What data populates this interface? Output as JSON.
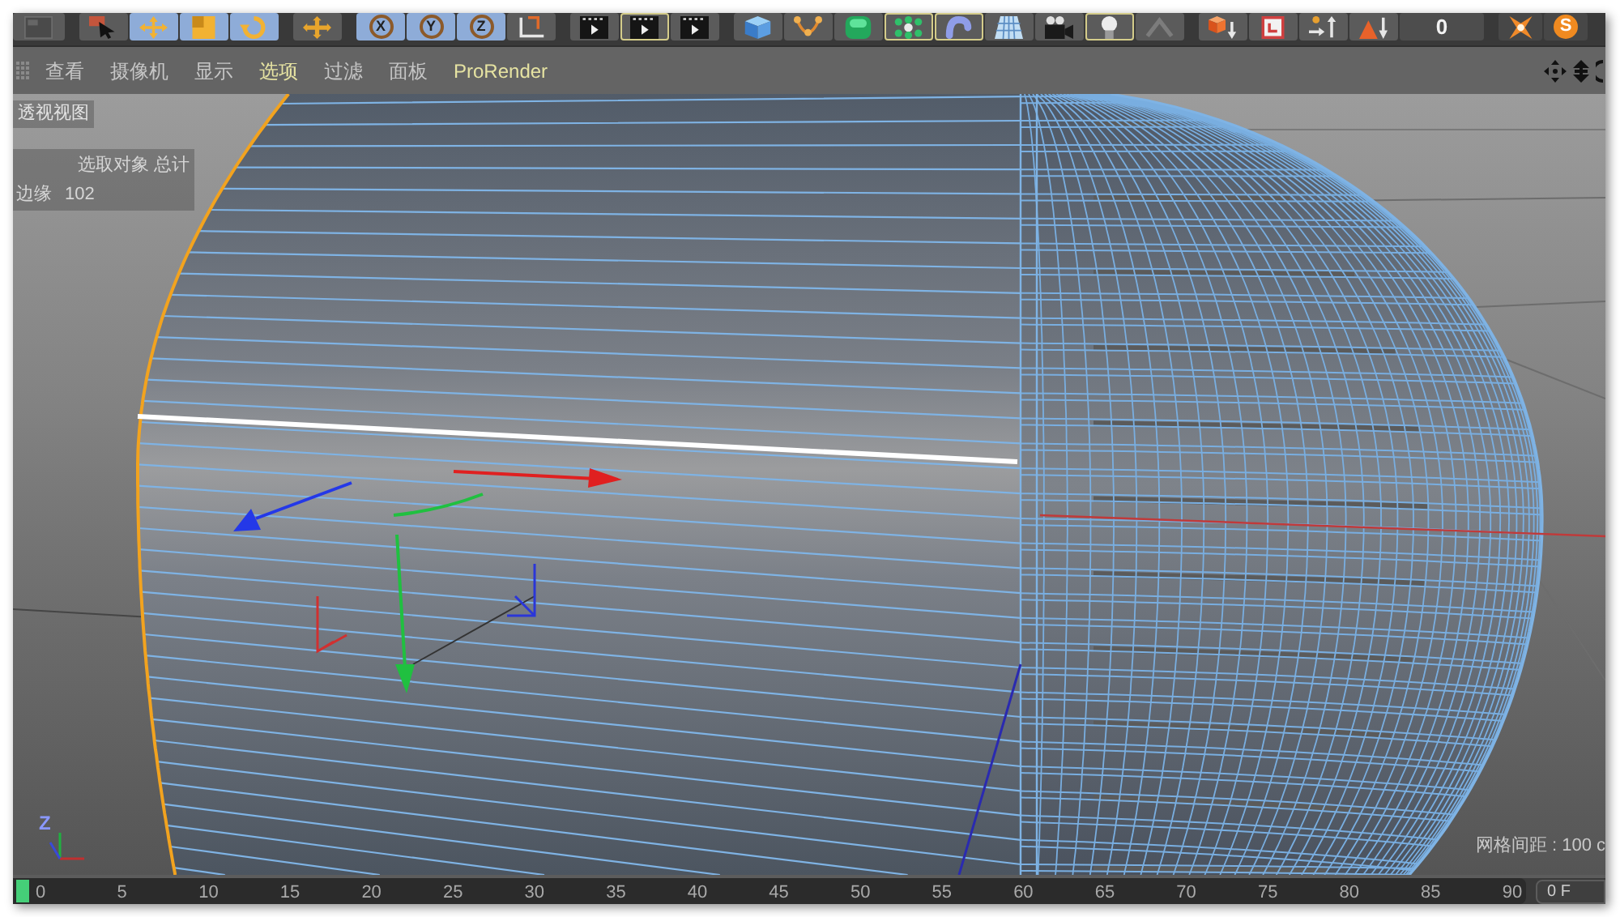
{
  "toolbar": {
    "groups": [
      [
        {
          "kind": "panel",
          "selected": false,
          "framed": false
        }
      ],
      [
        {
          "kind": "cursor",
          "selected": false,
          "framed": false
        },
        {
          "kind": "move",
          "selected": true,
          "framed": false
        },
        {
          "kind": "scale",
          "selected": true,
          "framed": false
        },
        {
          "kind": "rotate",
          "selected": true,
          "framed": false
        }
      ],
      [
        {
          "kind": "transform",
          "selected": false,
          "framed": false
        }
      ],
      [
        {
          "kind": "axis",
          "label": "X",
          "selected": true,
          "framed": false
        },
        {
          "kind": "axis",
          "label": "Y",
          "selected": true,
          "framed": false
        },
        {
          "kind": "axis",
          "label": "Z",
          "selected": true,
          "framed": false
        },
        {
          "kind": "coordinates",
          "selected": false,
          "framed": false
        }
      ],
      [
        {
          "kind": "render",
          "selected": false,
          "framed": false
        },
        {
          "kind": "render",
          "selected": false,
          "framed": true
        },
        {
          "kind": "render",
          "selected": false,
          "framed": false
        }
      ],
      [
        {
          "kind": "cube",
          "selected": false,
          "framed": false
        },
        {
          "kind": "spline",
          "selected": false,
          "framed": false
        },
        {
          "kind": "nurbs",
          "selected": false,
          "framed": false
        },
        {
          "kind": "mograph",
          "selected": false,
          "framed": true
        },
        {
          "kind": "deformer",
          "selected": false,
          "framed": true
        },
        {
          "kind": "floor",
          "selected": false,
          "framed": false
        },
        {
          "kind": "camera",
          "selected": false,
          "framed": false
        },
        {
          "kind": "light",
          "selected": false,
          "framed": true
        },
        {
          "kind": "caret",
          "selected": false,
          "framed": false
        }
      ],
      [
        {
          "kind": "cube_arrow",
          "selected": false,
          "framed": false
        },
        {
          "kind": "frame",
          "selected": false,
          "framed": false
        },
        {
          "kind": "sort",
          "selected": false,
          "framed": false
        },
        {
          "kind": "triangle_arrow",
          "selected": false,
          "framed": false
        },
        {
          "kind": "value",
          "label": "0",
          "selected": false,
          "framed": false
        }
      ],
      [
        {
          "kind": "burst",
          "selected": false,
          "framed": false
        },
        {
          "kind": "logo",
          "label": "S",
          "selected": false,
          "framed": false
        }
      ]
    ]
  },
  "menu": {
    "items": [
      {
        "label": "查看",
        "highlighted": false
      },
      {
        "label": "摄像机",
        "highlighted": false
      },
      {
        "label": "显示",
        "highlighted": false
      },
      {
        "label": "选项",
        "highlighted": true
      },
      {
        "label": "过滤",
        "highlighted": false
      },
      {
        "label": "面板",
        "highlighted": false
      },
      {
        "label": "ProRender",
        "highlighted": true
      }
    ]
  },
  "viewport": {
    "view_name": "透视视图",
    "stats": {
      "heading": "选取对象 总计",
      "rows": [
        {
          "label": "边缘",
          "value": "102"
        }
      ]
    },
    "axis_label": "Z",
    "grid_spacing": "网格间距 : 100 c"
  },
  "timeline": {
    "frames": [
      "0",
      "5",
      "10",
      "15",
      "20",
      "25",
      "30",
      "35",
      "40",
      "45",
      "50",
      "55",
      "60",
      "65",
      "70",
      "75",
      "80",
      "85",
      "90"
    ],
    "frame_field": "0 F"
  }
}
